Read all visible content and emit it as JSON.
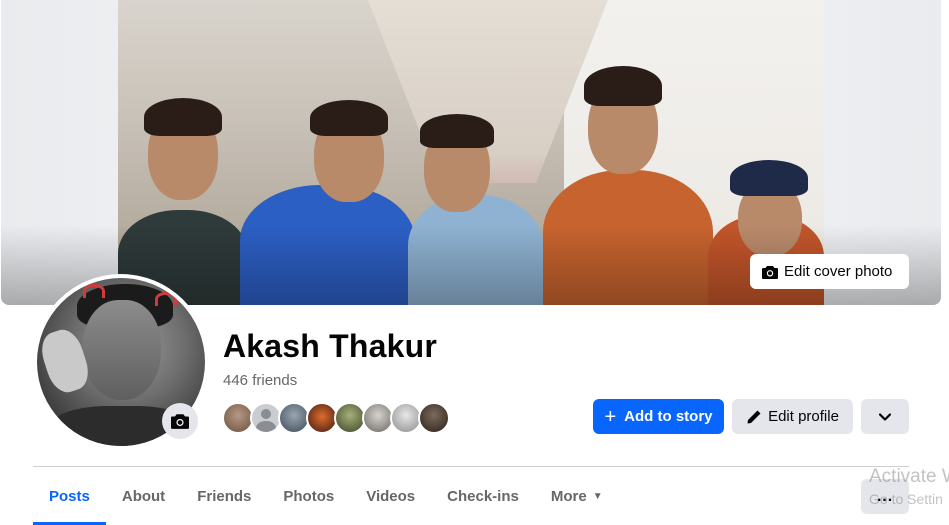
{
  "cover": {
    "edit_cover_label": "Edit cover photo",
    "icon": "camera-icon"
  },
  "profile": {
    "name": "Akash Thakur",
    "friends_count": "446 friends",
    "avatar_camera_icon": "camera-icon"
  },
  "friend_avatars": [
    "friend-1",
    "friend-2",
    "friend-3",
    "friend-4",
    "friend-5",
    "friend-6",
    "friend-7",
    "friend-8"
  ],
  "actions": {
    "add_story_label": "Add to story",
    "add_story_icon": "plus-icon",
    "edit_profile_label": "Edit profile",
    "edit_profile_icon": "pencil-icon",
    "more_icon": "chevron-down-icon"
  },
  "tabs": [
    {
      "label": "Posts",
      "active": true
    },
    {
      "label": "About",
      "active": false
    },
    {
      "label": "Friends",
      "active": false
    },
    {
      "label": "Photos",
      "active": false
    },
    {
      "label": "Videos",
      "active": false
    },
    {
      "label": "Check-ins",
      "active": false
    },
    {
      "label": "More",
      "active": false
    }
  ],
  "tab_more_button": "...",
  "watermark": {
    "line1": "Activate W",
    "line2": "Go to Settin"
  },
  "colors": {
    "accent": "#0866ff",
    "secondary_button": "#e4e6eb",
    "muted_text": "#65676b"
  }
}
